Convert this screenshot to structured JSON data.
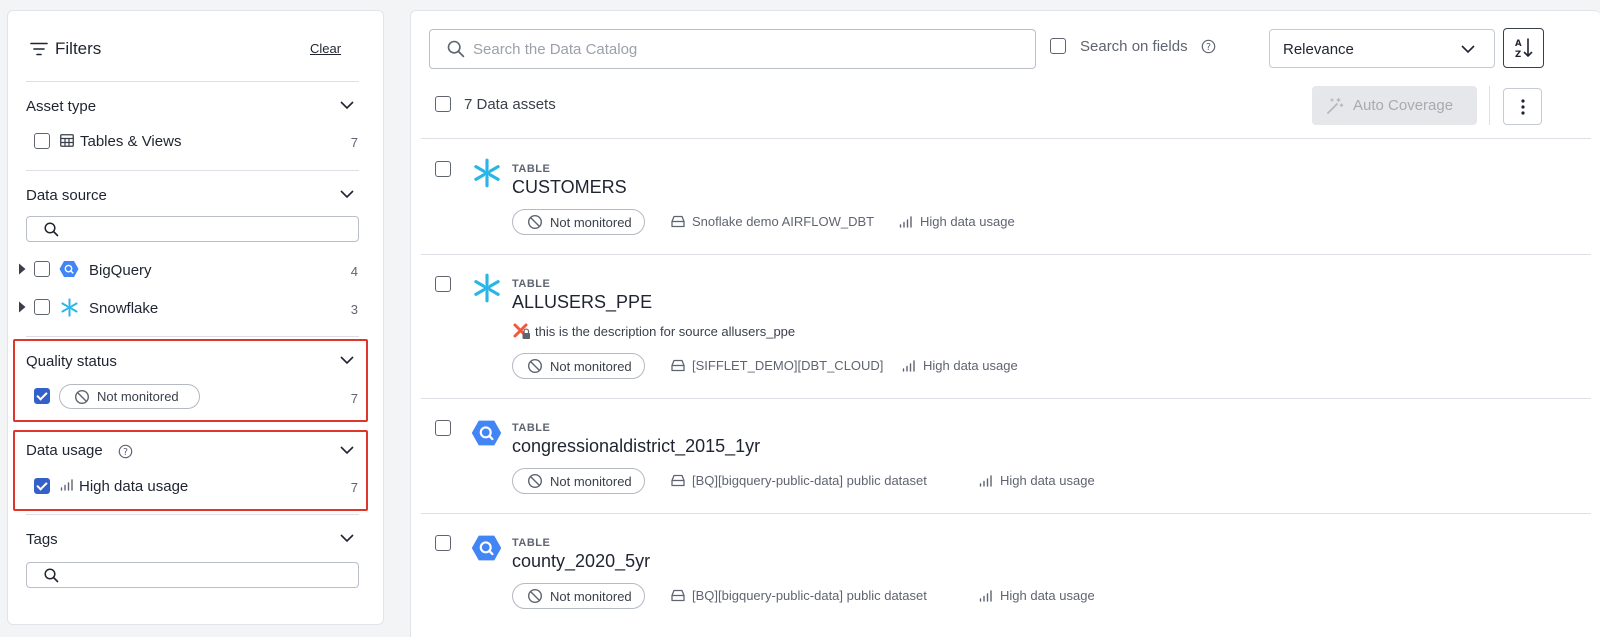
{
  "filters": {
    "title": "Filters",
    "clear_label": "Clear",
    "asset_type": {
      "title": "Asset type",
      "items": [
        {
          "label": "Tables & Views",
          "count": "7",
          "checked": false
        }
      ]
    },
    "data_source": {
      "title": "Data source",
      "search_placeholder": "",
      "items": [
        {
          "label": "BigQuery",
          "count": "4",
          "icon": "bigquery-icon",
          "checked": false
        },
        {
          "label": "Snowflake",
          "count": "3",
          "icon": "snowflake-icon",
          "checked": false
        }
      ]
    },
    "quality_status": {
      "title": "Quality status",
      "items": [
        {
          "label": "Not monitored",
          "count": "7",
          "checked": true
        }
      ]
    },
    "data_usage": {
      "title": "Data usage",
      "items": [
        {
          "label": "High data usage",
          "count": "7",
          "checked": true
        }
      ]
    },
    "tags": {
      "title": "Tags",
      "search_placeholder": ""
    }
  },
  "toolbar": {
    "search_placeholder": "Search the Data Catalog",
    "search_on_fields_label": "Search on fields",
    "sort_value": "Relevance",
    "asset_count_label": "7 Data assets",
    "auto_coverage_label": "Auto Coverage"
  },
  "results": [
    {
      "type": "TABLE",
      "name": "CUSTOMERS",
      "source_icon": "snowflake-icon",
      "description": "",
      "status": "Not monitored",
      "datasource": "Snoflake demo AIRFLOW_DBT",
      "usage": "High data usage"
    },
    {
      "type": "TABLE",
      "name": "ALLUSERS_PPE",
      "source_icon": "snowflake-icon",
      "description": "this is the description for source allusers_ppe",
      "status": "Not monitored",
      "datasource": "[SIFFLET_DEMO][DBT_CLOUD]",
      "usage": "High data usage"
    },
    {
      "type": "TABLE",
      "name": "congressionaldistrict_2015_1yr",
      "source_icon": "bigquery-icon",
      "description": "",
      "status": "Not monitored",
      "datasource": "[BQ][bigquery-public-data] public dataset",
      "usage": "High data usage"
    },
    {
      "type": "TABLE",
      "name": "county_2020_5yr",
      "source_icon": "bigquery-icon",
      "description": "",
      "status": "Not monitored",
      "datasource": "[BQ][bigquery-public-data] public dataset",
      "usage": "High data usage"
    }
  ],
  "colors": {
    "accent": "#3461c9",
    "highlight": "#e0352b",
    "snowflake": "#29b5e8",
    "bigquery": "#4285f4"
  }
}
